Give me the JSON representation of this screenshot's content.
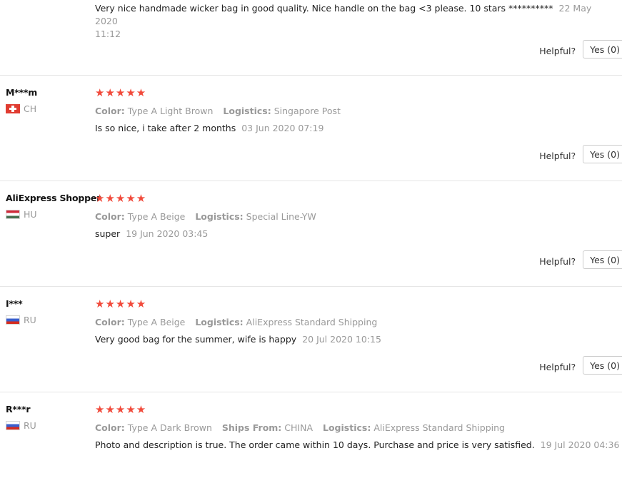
{
  "reviews": [
    {
      "text": "Very nice handmade wicker bag in good quality. Nice handle on the bag <3 please. 10 stars **********",
      "date": "22 May 2020",
      "time": "11:12",
      "helpful_label": "Helpful?",
      "yes_label": "Yes (0)"
    },
    {
      "user": "M***m",
      "country": "CH",
      "stars": "★★★★★",
      "attrs": [
        {
          "label": "Color:",
          "value": "Type A Light Brown"
        },
        {
          "label": "Logistics:",
          "value": "Singapore Post"
        }
      ],
      "text": "Is so nice, i take after 2 months",
      "date": "03 Jun 2020 07:19",
      "helpful_label": "Helpful?",
      "yes_label": "Yes (0)"
    },
    {
      "user": "AliExpress Shopper",
      "country": "HU",
      "stars": "★★★★★",
      "attrs": [
        {
          "label": "Color:",
          "value": "Type A Beige"
        },
        {
          "label": "Logistics:",
          "value": "Special Line-YW"
        }
      ],
      "text": "super",
      "date": "19 Jun 2020 03:45",
      "helpful_label": "Helpful?",
      "yes_label": "Yes (0)"
    },
    {
      "user": "I***",
      "country": "RU",
      "stars": "★★★★★",
      "attrs": [
        {
          "label": "Color:",
          "value": "Type A Beige"
        },
        {
          "label": "Logistics:",
          "value": "AliExpress Standard Shipping"
        }
      ],
      "text": "Very good bag for the summer, wife is happy",
      "date": "20 Jul 2020 10:15",
      "helpful_label": "Helpful?",
      "yes_label": "Yes (0)"
    },
    {
      "user": "R***r",
      "country": "RU",
      "stars": "★★★★★",
      "attrs": [
        {
          "label": "Color:",
          "value": "Type A Dark Brown"
        },
        {
          "label": "Ships From:",
          "value": "CHINA"
        },
        {
          "label": "Logistics:",
          "value": "AliExpress Standard Shipping"
        }
      ],
      "text": "Photo and description is true. The order came within 10 days. Purchase and price is very satisfied.",
      "date": "19 Jul 2020 04:36"
    }
  ],
  "colors": {
    "star": "#f14a3b",
    "muted": "#999999",
    "divider": "#e6e6e6"
  },
  "icons": {
    "flag_ch": "switzerland-flag-icon",
    "flag_hu": "hungary-flag-icon",
    "flag_ru": "russia-flag-icon"
  }
}
